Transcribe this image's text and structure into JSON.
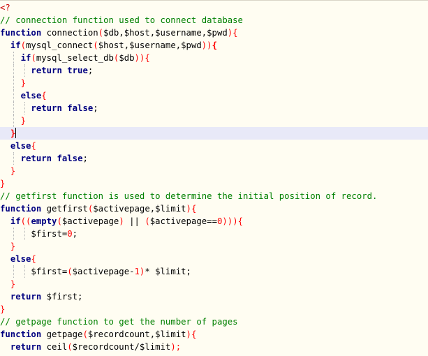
{
  "editor": {
    "lines": [
      [
        {
          "t": "<?",
          "c": "tg"
        }
      ],
      [
        {
          "t": "// connection function used to connect database",
          "c": "cm"
        }
      ],
      [
        {
          "t": "function",
          "c": "kw"
        },
        {
          "t": " connection"
        },
        {
          "t": "(",
          "c": "pr"
        },
        {
          "t": "$db,$host,$username,$pwd"
        },
        {
          "t": "){",
          "c": "pr"
        }
      ],
      [
        {
          "t": "  "
        },
        {
          "t": "if",
          "c": "kw"
        },
        {
          "t": "(",
          "c": "pr"
        },
        {
          "t": "mysql_connect"
        },
        {
          "t": "(",
          "c": "pr"
        },
        {
          "t": "$host,$username,$pwd"
        },
        {
          "t": "))",
          "c": "pr"
        },
        {
          "t": "{",
          "c": "br"
        }
      ],
      [
        {
          "t": "    "
        },
        {
          "t": "if",
          "c": "kw"
        },
        {
          "t": "(",
          "c": "pr"
        },
        {
          "t": "mysql_select_db"
        },
        {
          "t": "(",
          "c": "pr"
        },
        {
          "t": "$db"
        },
        {
          "t": ")){",
          "c": "pr"
        }
      ],
      [
        {
          "t": "      "
        },
        {
          "t": "return",
          "c": "kw"
        },
        {
          "t": " "
        },
        {
          "t": "true",
          "c": "kw"
        },
        {
          "t": ";"
        }
      ],
      [
        {
          "t": "    "
        },
        {
          "t": "}",
          "c": "pr"
        }
      ],
      [
        {
          "t": "    "
        },
        {
          "t": "else",
          "c": "kw"
        },
        {
          "t": "{",
          "c": "pr"
        }
      ],
      [
        {
          "t": "      "
        },
        {
          "t": "return",
          "c": "kw"
        },
        {
          "t": " "
        },
        {
          "t": "false",
          "c": "kw"
        },
        {
          "t": ";"
        }
      ],
      [
        {
          "t": "    "
        },
        {
          "t": "}",
          "c": "pr"
        }
      ],
      [
        {
          "t": "  "
        },
        {
          "t": "}",
          "c": "br"
        },
        {
          "caret": true
        }
      ],
      [
        {
          "t": "  "
        },
        {
          "t": "else",
          "c": "kw"
        },
        {
          "t": "{",
          "c": "pr"
        }
      ],
      [
        {
          "t": "    "
        },
        {
          "t": "return",
          "c": "kw"
        },
        {
          "t": " "
        },
        {
          "t": "false",
          "c": "kw"
        },
        {
          "t": ";"
        }
      ],
      [
        {
          "t": "  "
        },
        {
          "t": "}",
          "c": "pr"
        }
      ],
      [
        {
          "t": "}",
          "c": "pr"
        }
      ],
      [
        {
          "t": "// getfirst function is used to determine the initial position of record.",
          "c": "cm"
        }
      ],
      [
        {
          "t": "function",
          "c": "kw"
        },
        {
          "t": " getfirst"
        },
        {
          "t": "(",
          "c": "pr"
        },
        {
          "t": "$activepage,$limit"
        },
        {
          "t": "){",
          "c": "pr"
        }
      ],
      [
        {
          "t": "  "
        },
        {
          "t": "if",
          "c": "kw"
        },
        {
          "t": "((",
          "c": "pr"
        },
        {
          "t": "empty",
          "c": "kw"
        },
        {
          "t": "(",
          "c": "pr"
        },
        {
          "t": "$activepage"
        },
        {
          "t": ")",
          "c": "pr"
        },
        {
          "t": " || "
        },
        {
          "t": "(",
          "c": "pr"
        },
        {
          "t": "$activepage=="
        },
        {
          "t": "0",
          "c": "num"
        },
        {
          "t": "))){",
          "c": "pr"
        }
      ],
      [
        {
          "t": "      "
        },
        {
          "t": "$first="
        },
        {
          "t": "0",
          "c": "num"
        },
        {
          "t": ";"
        }
      ],
      [
        {
          "t": "  "
        },
        {
          "t": "}",
          "c": "pr"
        }
      ],
      [
        {
          "t": "  "
        },
        {
          "t": "else",
          "c": "kw"
        },
        {
          "t": "{",
          "c": "pr"
        }
      ],
      [
        {
          "t": "      "
        },
        {
          "t": "$first="
        },
        {
          "t": "(",
          "c": "pr"
        },
        {
          "t": "$activepage-"
        },
        {
          "t": "1",
          "c": "num"
        },
        {
          "t": ")",
          "c": "pr"
        },
        {
          "t": "* $limit;"
        }
      ],
      [
        {
          "t": "  "
        },
        {
          "t": "}",
          "c": "pr"
        }
      ],
      [
        {
          "t": "  "
        },
        {
          "t": "return",
          "c": "kw"
        },
        {
          "t": " $first;"
        }
      ],
      [
        {
          "t": "}",
          "c": "pr"
        }
      ],
      [
        {
          "t": "// getpage function to get the number of pages",
          "c": "cm"
        }
      ],
      [
        {
          "t": "function",
          "c": "kw"
        },
        {
          "t": " getpage"
        },
        {
          "t": "(",
          "c": "pr"
        },
        {
          "t": "$recordcount,$limit"
        },
        {
          "t": "){",
          "c": "pr"
        }
      ],
      [
        {
          "t": "  "
        },
        {
          "t": "return",
          "c": "kw"
        },
        {
          "t": " ceil"
        },
        {
          "t": "(",
          "c": "pr"
        },
        {
          "t": "$recordcount/$limit"
        },
        {
          "t": ");",
          "c": "pr"
        }
      ]
    ],
    "current_line": 11,
    "colors": {
      "background": "#fffdf2",
      "current_line": "#e8e9f8",
      "keyword": "#000080",
      "comment": "#008000",
      "number": "#ff0000",
      "paren": "#ff0000",
      "bracket_match": "#ff0000",
      "indent_guide": "#b8b8b8"
    }
  }
}
